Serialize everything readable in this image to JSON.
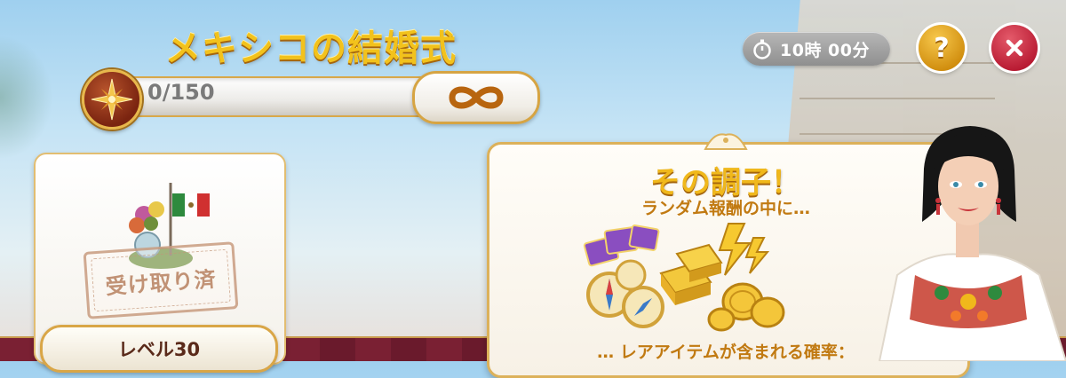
{
  "event": {
    "title": "メキシコの結婚式",
    "progress": {
      "current": 0,
      "total": 150,
      "label": "0/150",
      "fraction": 0
    }
  },
  "timer": {
    "text": "10時 00分"
  },
  "buttons": {
    "help_label": "?"
  },
  "reward_card": {
    "stamp_text": "受け取り済",
    "level_label": "レベル30"
  },
  "info_panel": {
    "title": "その調子！",
    "subtitle": "ランダム報酬の中に…",
    "bottom_text": "… レアアイテムが含まれる確率："
  },
  "colors": {
    "title_gold": "#f2c21c",
    "panel_border": "#dcb15a",
    "close_red": "#b81a32",
    "help_gold": "#d08d0e",
    "text_brown": "#c17a12"
  },
  "icons": [
    "compass-icon",
    "infinity-icon",
    "stopwatch-icon",
    "question-icon",
    "close-icon",
    "mexican-flag-icon",
    "gold-bars-icon",
    "compass-items-icon",
    "tickets-icon",
    "lightning-icon",
    "coins-icon"
  ]
}
